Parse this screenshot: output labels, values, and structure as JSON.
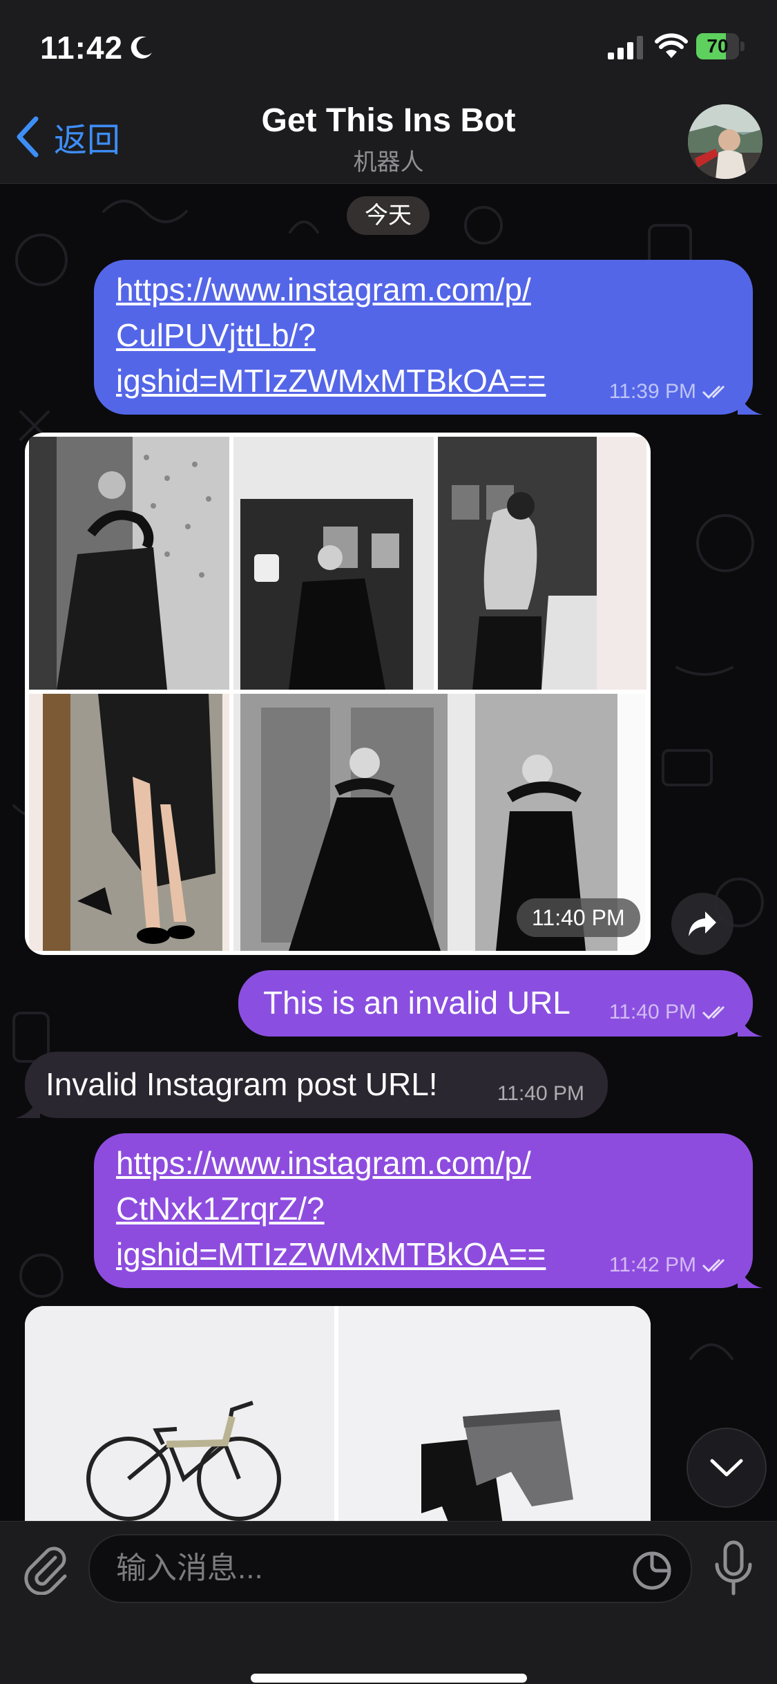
{
  "status_bar": {
    "time": "11:42",
    "battery": "70",
    "battery_level": 0.7
  },
  "nav": {
    "back_label": "返回",
    "title": "Get This Ins Bot",
    "subtitle": "机器人"
  },
  "chat": {
    "date_badge": "今天",
    "messages": [
      {
        "lines": [
          "https://www.instagram.com/p/",
          "CulPUVjttLb/?",
          "igshid=MTIzZWMxMTBkOA=="
        ],
        "time": "11:39 PM"
      },
      {
        "time": "11:40 PM"
      },
      {
        "text": "This is an invalid URL",
        "time": "11:40 PM"
      },
      {
        "text": "Invalid Instagram post URL!",
        "time": "11:40 PM"
      },
      {
        "lines": [
          "https://www.instagram.com/p/",
          "CtNxk1ZrqrZ/?",
          "igshid=MTIzZWMxMTBkOA=="
        ],
        "time": "11:42 PM"
      }
    ]
  },
  "input": {
    "placeholder": "输入消息..."
  },
  "colors": {
    "accent": "#3e8ef7",
    "outgoing_blue": "#5466e8",
    "outgoing_purple": "#8a4fe0",
    "incoming": "#2b2730"
  }
}
